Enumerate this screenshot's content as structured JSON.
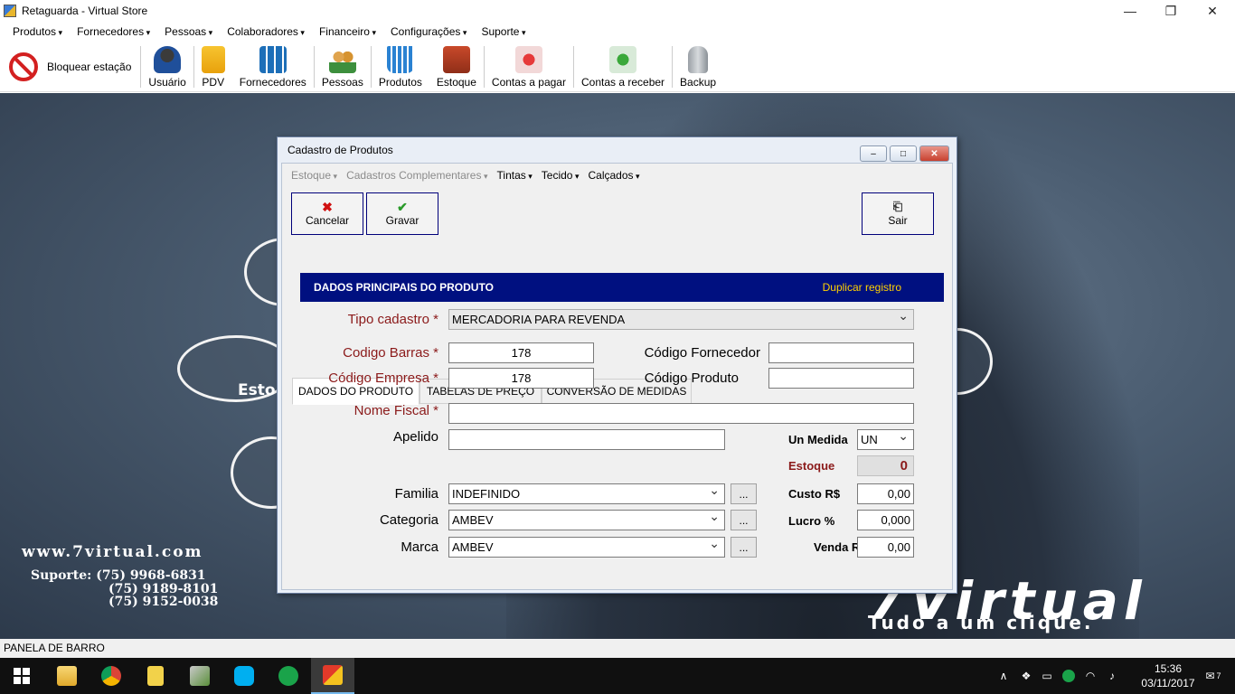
{
  "window": {
    "title": "Retaguarda - Virtual Store",
    "minimize": "—",
    "maximize": "❐",
    "close": "✕"
  },
  "menubar": [
    "Produtos",
    "Fornecedores",
    "Pessoas",
    "Colaboradores",
    "Financeiro",
    "Configurações",
    "Suporte"
  ],
  "toolbar": {
    "block_label": "Bloquear estação",
    "buttons": [
      "Usuário",
      "PDV",
      "Fornecedores",
      "Pessoas",
      "Produtos",
      "Estoque",
      "Contas a pagar",
      "Contas a receber",
      "Backup"
    ]
  },
  "background": {
    "website": "www.7virtual.com",
    "support_label": "Suporte: (75) 9968-6831",
    "phone2": "(75) 9189-8101",
    "phone3": "(75) 9152-0038",
    "ring_label": "Esto",
    "brand": "7Virtual",
    "slogan": "Tudo a um clique."
  },
  "dialog": {
    "title": "Cadastro de Produtos",
    "menu": [
      {
        "label": "Estoque",
        "disabled": true
      },
      {
        "label": "Cadastros Complementares",
        "disabled": true
      },
      {
        "label": "Tintas",
        "disabled": false
      },
      {
        "label": "Tecido",
        "disabled": false
      },
      {
        "label": "Calçados",
        "disabled": false
      }
    ],
    "actions": {
      "cancel": "Cancelar",
      "save": "Gravar",
      "exit": "Sair"
    },
    "tabs": [
      "DADOS DO PRODUTO",
      "TABELAS DE PREÇO",
      "CONVERSÃO DE MEDIDAS"
    ],
    "section_title": "DADOS PRINCIPAIS DO PRODUTO",
    "duplicate_link": "Duplicar registro",
    "fields": {
      "tipo_cadastro": {
        "label": "Tipo cadastro *",
        "value": "MERCADORIA PARA REVENDA"
      },
      "codigo_barras": {
        "label": "Codigo Barras *",
        "value": "178"
      },
      "codigo_empresa": {
        "label": "Código Empresa *",
        "value": "178"
      },
      "codigo_fornecedor": {
        "label": "Código Fornecedor",
        "value": ""
      },
      "codigo_produto": {
        "label": "Código Produto",
        "value": ""
      },
      "nome_fiscal": {
        "label": "Nome Fiscal *",
        "value": ""
      },
      "apelido": {
        "label": "Apelido",
        "value": ""
      },
      "familia": {
        "label": "Familia",
        "value": "INDEFINIDO"
      },
      "categoria": {
        "label": "Categoria",
        "value": "AMBEV"
      },
      "marca": {
        "label": "Marca",
        "value": "AMBEV"
      },
      "un_medida": {
        "label": "Un Medida",
        "value": "UN"
      },
      "estoque": {
        "label": "Estoque",
        "value": "0"
      },
      "custo": {
        "label": "Custo R$",
        "value": "0,00"
      },
      "lucro": {
        "label": "Lucro %",
        "value": "0,000"
      },
      "venda": {
        "label": "Venda R$",
        "value": "0,00"
      }
    },
    "browse_button": "..."
  },
  "statusbar": {
    "text": "PANELA DE BARRO"
  },
  "taskbar": {
    "clock_time": "15:36",
    "clock_date": "03/11/2017",
    "notification_count": "7",
    "apps": [
      "start-icon",
      "file-explorer-icon",
      "chrome-icon",
      "sticky-notes-icon",
      "tools-icon",
      "skype-icon",
      "k-app-icon",
      "virtual-store-icon"
    ]
  },
  "colors": {
    "header_blue": "#001080",
    "required_red": "#8b1a1a",
    "link_yellow": "#ffd000",
    "border_navy": "#00007a"
  }
}
